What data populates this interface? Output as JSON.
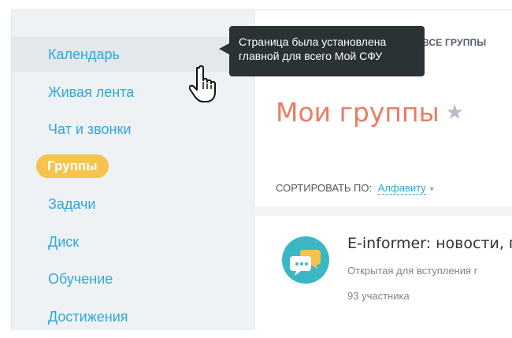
{
  "sidebar": {
    "items": [
      {
        "label": "Календарь",
        "state": "hovered"
      },
      {
        "label": "Живая лента",
        "state": "normal"
      },
      {
        "label": "Чат и звонки",
        "state": "normal"
      },
      {
        "label": "Группы",
        "state": "active"
      },
      {
        "label": "Задачи",
        "state": "normal"
      },
      {
        "label": "Диск",
        "state": "normal"
      },
      {
        "label": "Обучение",
        "state": "normal"
      },
      {
        "label": "Достижения",
        "state": "normal"
      }
    ]
  },
  "header": {
    "tab_label": "ВСЕ ГРУППЫ"
  },
  "main": {
    "title": "Мои группы",
    "star_icon": "star-icon",
    "sort_label": "СОРТИРОВАТЬ ПО:",
    "sort_value": "Алфавиту",
    "groups": [
      {
        "name": "E-informer: новости, п",
        "type": "Открытая для вступления г",
        "members": "93 участника",
        "avatar_icon": "chat-bubbles-icon"
      }
    ]
  },
  "tooltip": {
    "line1": "Страница была установлена",
    "line2": "главной для всего Мой СФУ"
  },
  "cursor_icon": "hand-pointer-icon",
  "colors": {
    "link": "#2fa8d8",
    "active_pill": "#f6c34d",
    "title": "#e97c64",
    "tooltip_bg": "#2b3236",
    "sidebar_bg": "#eef2f4"
  }
}
